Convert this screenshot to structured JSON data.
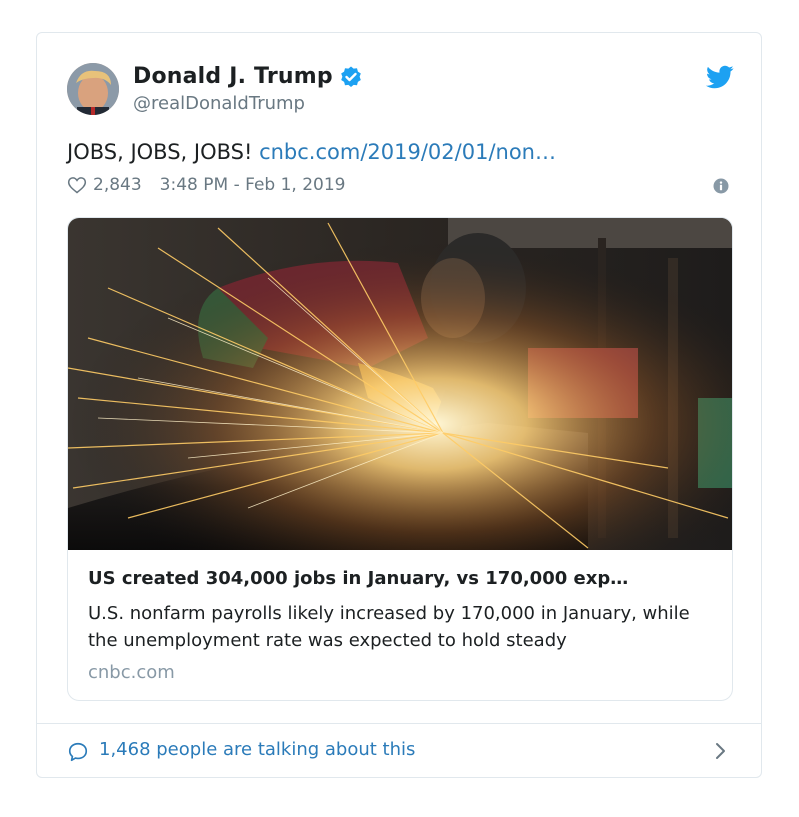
{
  "tweet": {
    "author_name": "Donald J. Trump",
    "handle": "@realDonaldTrump",
    "text": "JOBS, JOBS, JOBS! ",
    "link_text": "cnbc.com/2019/02/01/non…",
    "likes": "2,843",
    "timestamp": "3:48 PM - Feb 1, 2019"
  },
  "card": {
    "title": "US created 304,000 jobs in January, vs 170,000 exp…",
    "description": "U.S. nonfarm payrolls likely increased by 170,000 in January, while the unemployment rate was expected to hold steady",
    "domain": "cnbc.com"
  },
  "footer": {
    "talking": "1,468 people are talking about this"
  },
  "colors": {
    "link": "#2b7bb9",
    "verified": "#1da1f2",
    "muted": "#697882",
    "border": "#e1e8ed"
  },
  "icons": [
    "verified-badge-icon",
    "twitter-bird-icon",
    "heart-icon",
    "info-icon",
    "speech-bubble-icon",
    "chevron-right-icon"
  ]
}
